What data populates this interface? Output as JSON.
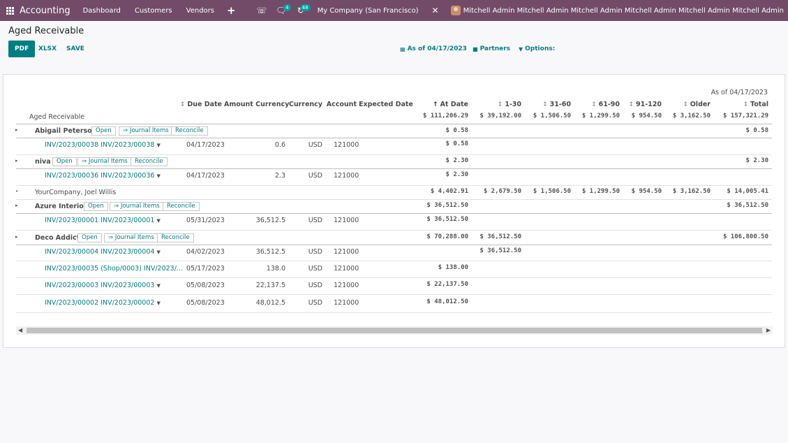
{
  "nav": {
    "brand": "Accounting",
    "menus": [
      "Dashboard",
      "Customers",
      "Vendors"
    ],
    "plus": "+",
    "chat_badge": "4",
    "activity_badge": "48",
    "company": "My Company (San Francisco)",
    "user": "Mitchell Admin Mitchell Admin Mitchell Admin Mitchell Admin Mitchell Admin Mitchell Admin"
  },
  "page": {
    "title": "Aged Receivable",
    "buttons": [
      "PDF",
      "XLSX",
      "SAVE"
    ],
    "filter_date": "As of 04/17/2023",
    "filter_partners": "Partners",
    "filter_options": "Options:"
  },
  "report": {
    "as_of": "As of 04/17/2023",
    "columns": [
      "Due Date",
      "Amount Currency",
      "Currency",
      "Account",
      "Expected Date",
      "At Date",
      "1-30",
      "31-60",
      "61-90",
      "91-120",
      "Older",
      "Total"
    ],
    "total_label": "Aged Receivable",
    "totals": [
      "$ 111,206.29",
      "$ 39,192.00",
      "$ 1,506.50",
      "$ 1,299.50",
      "$ 954.50",
      "$ 3,162.50",
      "$ 157,321.29"
    ],
    "chip_labels": {
      "open": "Open",
      "journal": "⇒ Journal Items",
      "reconcile": "Reconcile"
    },
    "partners": [
      {
        "name": "Abigail Peterson",
        "at_date": "$ 0.58",
        "total": "$ 0.58",
        "lines": [
          {
            "ref": "INV/2023/00038 INV/2023/00038",
            "due": "04/17/2023",
            "amount": "0.6",
            "currency": "USD",
            "account": "121000",
            "at_date": "$ 0.58"
          }
        ]
      },
      {
        "name": "niva",
        "at_date": "$ 2.30",
        "total": "$ 2.30",
        "lines": [
          {
            "ref": "INV/2023/00036 INV/2023/00036",
            "due": "04/17/2023",
            "amount": "2.3",
            "currency": "USD",
            "account": "121000",
            "at_date": "$ 2.30"
          }
        ]
      },
      {
        "name": "YourCompany, Joel Willis",
        "at_date": "$ 4,402.91",
        "b1_30": "$ 2,679.50",
        "b31_60": "$ 1,506.50",
        "b61_90": "$ 1,299.50",
        "b91_120": "$ 954.50",
        "older": "$ 3,162.50",
        "total": "$ 14,005.41"
      },
      {
        "name": "Azure Interior",
        "at_date": "$ 36,512.50",
        "total": "$ 36,512.50",
        "lines": [
          {
            "ref": "INV/2023/00001 INV/2023/00001",
            "due": "05/31/2023",
            "amount": "36,512.5",
            "currency": "USD",
            "account": "121000",
            "at_date": "$ 36,512.50"
          }
        ]
      },
      {
        "name": "Deco Addict",
        "at_date": "$ 70,288.00",
        "b1_30": "$ 36,512.50",
        "total": "$ 106,800.50",
        "lines": [
          {
            "ref": "INV/2023/00004 INV/2023/00004",
            "due": "04/02/2023",
            "amount": "36,512.5",
            "currency": "USD",
            "account": "121000",
            "b1_30": "$ 36,512.50"
          },
          {
            "ref": "INV/2023/00035 (Shop/0003) INV/2023/...",
            "due": "05/17/2023",
            "amount": "138.0",
            "currency": "USD",
            "account": "121000",
            "at_date": "$ 138.00"
          },
          {
            "ref": "INV/2023/00003 INV/2023/00003",
            "due": "05/08/2023",
            "amount": "22,137.5",
            "currency": "USD",
            "account": "121000",
            "at_date": "$ 22,137.50"
          },
          {
            "ref": "INV/2023/00002 INV/2023/00002",
            "due": "05/08/2023",
            "amount": "48,012.5",
            "currency": "USD",
            "account": "121000",
            "at_date": "$ 48,012.50"
          }
        ]
      }
    ]
  }
}
